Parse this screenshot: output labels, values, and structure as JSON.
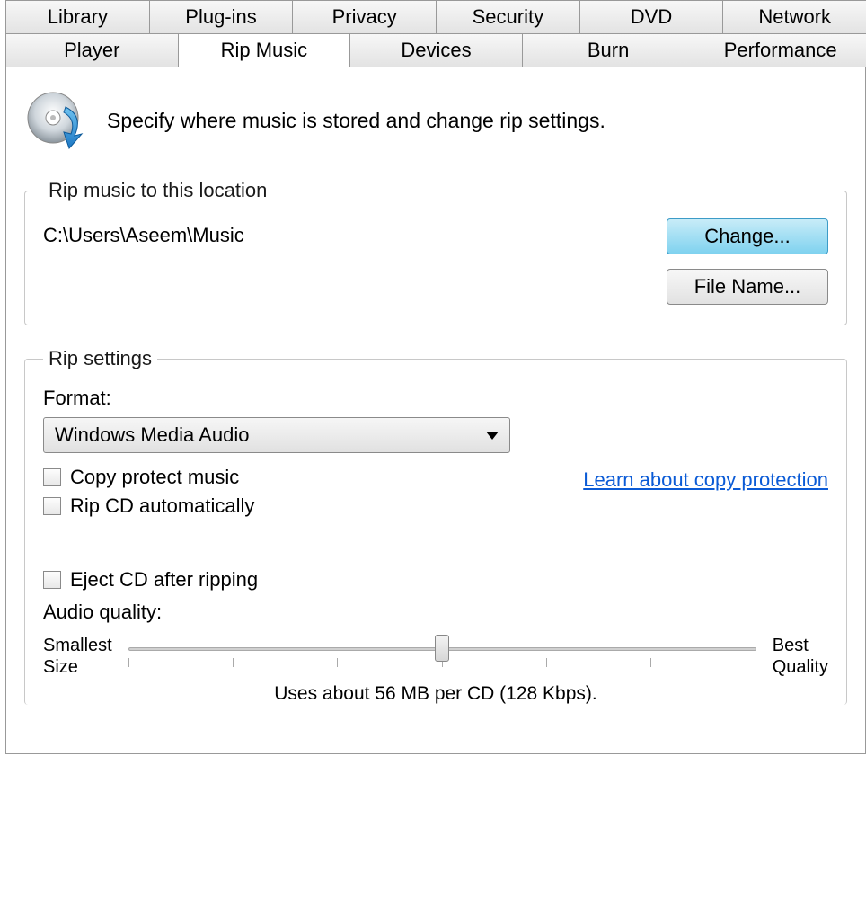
{
  "tabs": {
    "row1": [
      "Library",
      "Plug-ins",
      "Privacy",
      "Security",
      "DVD",
      "Network"
    ],
    "row2": [
      "Player",
      "Rip Music",
      "Devices",
      "Burn",
      "Performance"
    ],
    "active": "Rip Music"
  },
  "intro": "Specify where music is stored and change rip settings.",
  "location": {
    "legend": "Rip music to this location",
    "path": "C:\\Users\\Aseem\\Music",
    "change_label": "Change...",
    "filename_label": "File Name..."
  },
  "settings": {
    "legend": "Rip settings",
    "format_label": "Format:",
    "format_value": "Windows Media Audio",
    "copy_protect_label": "Copy protect music",
    "learn_link": "Learn about copy protection",
    "auto_rip_label": "Rip CD automatically",
    "eject_label": "Eject CD after ripping",
    "quality_label": "Audio quality:",
    "slider_left": "Smallest\nSize",
    "slider_right": "Best\nQuality",
    "slider_caption": "Uses about 56 MB per CD (128 Kbps)."
  }
}
